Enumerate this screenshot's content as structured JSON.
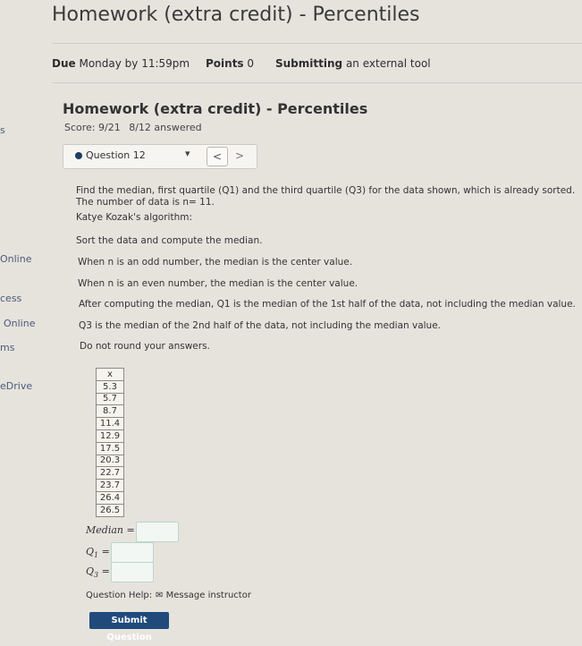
{
  "header": {
    "title": "Homework (extra credit) - Percentiles",
    "due_label": "Due",
    "due_value": "Monday by 11:59pm",
    "points_label": "Points",
    "points_value": "0",
    "submitting_label": "Submitting",
    "submitting_value": "an external tool"
  },
  "sidebar": {
    "items": [
      {
        "label": "s"
      },
      {
        "label": "Online"
      },
      {
        "label": "cess"
      },
      {
        "label": "Online"
      },
      {
        "label": "ms"
      },
      {
        "label": "eDrive"
      }
    ]
  },
  "assignment": {
    "title": "Homework (extra credit) - Percentiles",
    "score": "Score: 9/21",
    "answered": "8/12 answered"
  },
  "question_nav": {
    "label": "Question 12",
    "prev": "<",
    "next": ">"
  },
  "problem": {
    "line1": "Find the median, first quartile (Q1) and the third quartile (Q3) for the data shown, which is already sorted.",
    "line2": "The number of data is n= 11.",
    "algo_title": "Katye Kozak's algorithm:",
    "step1": "Sort the data and compute the median.",
    "step2": "When n is an odd number, the median is the center value.",
    "step3": "When n is an even number, the median is the center value.",
    "step4": "After computing the median, Q1 is the median of the 1st half of the data, not including the median value.",
    "step5": "Q3 is the median of the 2nd half of the data, not including the median value.",
    "step6": "Do not round your answers."
  },
  "data_table": {
    "header": "x",
    "values": [
      "5.3",
      "5.7",
      "8.7",
      "11.4",
      "12.9",
      "17.5",
      "20.3",
      "22.7",
      "23.7",
      "26.4",
      "26.5"
    ]
  },
  "answers": {
    "median_label": "Median",
    "q1_label": "Q",
    "q1_sub": "1",
    "q3_label": "Q",
    "q3_sub": "3",
    "median_value": "",
    "q1_value": "",
    "q3_value": ""
  },
  "footer": {
    "help_label": "Question Help:",
    "message_label": "Message instructor",
    "submit_label": "Submit Question"
  }
}
